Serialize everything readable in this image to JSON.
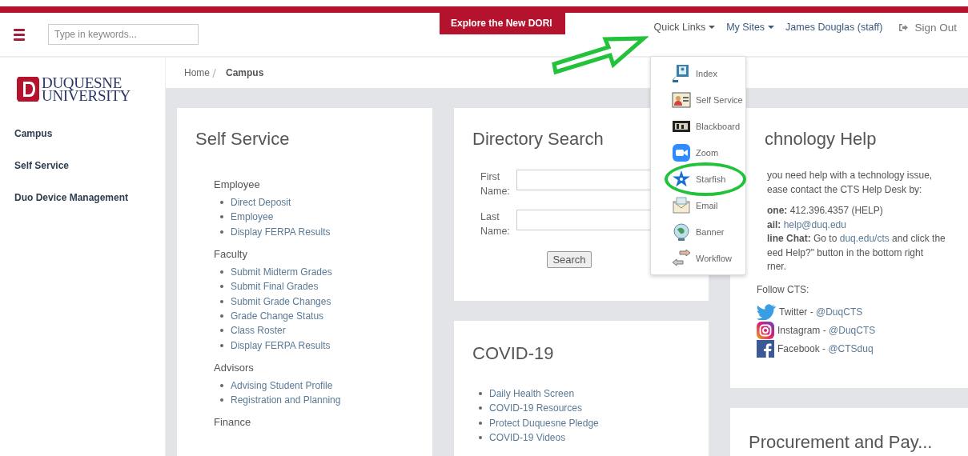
{
  "header": {
    "search": {
      "placeholder": "Type in keywords..."
    },
    "banner": "Explore the New DORI",
    "nav": [
      {
        "label": "Quick Links",
        "kind": "menu",
        "expanded": true
      },
      {
        "label": "My Sites",
        "kind": "menu",
        "expanded": false
      },
      {
        "label": "James Douglas (staff)",
        "kind": "user"
      },
      {
        "label": "Sign Out",
        "kind": "signout"
      }
    ]
  },
  "quick_links": [
    {
      "label": "Index",
      "highlighted": false
    },
    {
      "label": "Self Service",
      "highlighted": false
    },
    {
      "label": "Blackboard",
      "highlighted": false
    },
    {
      "label": "Zoom",
      "highlighted": false
    },
    {
      "label": "Starfish",
      "highlighted": true
    },
    {
      "label": "Email",
      "highlighted": false
    },
    {
      "label": "Banner",
      "highlighted": false
    },
    {
      "label": "Workflow",
      "highlighted": false
    }
  ],
  "sidebar": {
    "logo": [
      "DUQUESNE",
      "UNIVERSITY"
    ],
    "items": [
      {
        "label": "Campus"
      },
      {
        "label": "Self Service"
      },
      {
        "label": "Duo Device Management"
      }
    ]
  },
  "breadcrumb": [
    {
      "label": "Home",
      "current": false
    },
    {
      "label": "Campus",
      "current": true
    }
  ],
  "self_service": {
    "title": "Self Service",
    "sections": [
      {
        "title": "Employee",
        "links": [
          "Direct Deposit",
          "Employee",
          "Display FERPA Results"
        ]
      },
      {
        "title": "Faculty",
        "links": [
          "Submit Midterm Grades",
          "Submit Final Grades",
          "Submit Grade Changes",
          "Grade Change Status",
          "Class Roster",
          "Display FERPA Results"
        ]
      },
      {
        "title": "Advisors",
        "links": [
          "Advising Student Profile",
          "Registration and Planning"
        ]
      },
      {
        "title": "Finance"
      }
    ]
  },
  "directory_search": {
    "title": "Directory Search",
    "fields": [
      {
        "label": "First Name:"
      },
      {
        "label": "Last Name:"
      }
    ],
    "button": "Search"
  },
  "covid": {
    "title": "COVID-19",
    "links": [
      "Daily Health Screen",
      "COVID-19 Resources",
      "Protect Duquesne Pledge",
      "COVID-19 Videos"
    ]
  },
  "technology_help": {
    "title": "chnology Help",
    "lines": [
      {
        "text": "you need help with a technology issue,"
      },
      {
        "text": "ease contact the CTS Help Desk by:"
      },
      {
        "bold": "one:",
        "text": "412.396.4357 (HELP)"
      },
      {
        "bold": "ail:",
        "link": "help@duq.edu"
      },
      {
        "bold": "line Chat:",
        "text": "Go to",
        "link": "duq.edu/cts",
        "after": "and click the"
      },
      {
        "text": "eed Help?\" button in the bottom right"
      },
      {
        "text": "rner."
      }
    ],
    "follow": "Follow CTS:",
    "social": [
      {
        "label": "Twitter -",
        "handle": "@DuqCTS"
      },
      {
        "label": "Instagram -",
        "handle": "@DuqCTS"
      },
      {
        "label": "Facebook -",
        "handle": "@CTSduq"
      }
    ]
  },
  "procurement": {
    "title": "Procurement and Pay..."
  }
}
